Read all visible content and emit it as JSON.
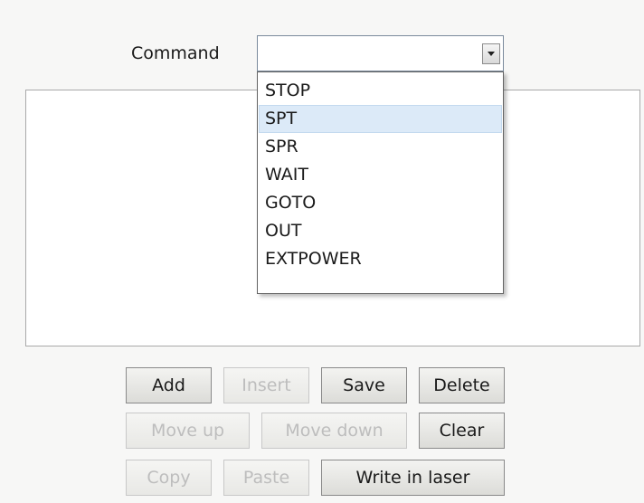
{
  "command": {
    "label": "Command",
    "value": ""
  },
  "dropdown": {
    "options": [
      "STOP",
      "SPT",
      "SPR",
      "WAIT",
      "GOTO",
      "OUT",
      "EXTPOWER"
    ],
    "highlighted": "SPT"
  },
  "buttons": {
    "add": "Add",
    "insert": "Insert",
    "save": "Save",
    "delete": "Delete",
    "move_up": "Move up",
    "move_down": "Move down",
    "clear": "Clear",
    "copy": "Copy",
    "paste": "Paste",
    "write_in_laser": "Write in laser"
  },
  "colors": {
    "highlight": "#dceaf8",
    "disabled_text": "#bdbdbd"
  }
}
